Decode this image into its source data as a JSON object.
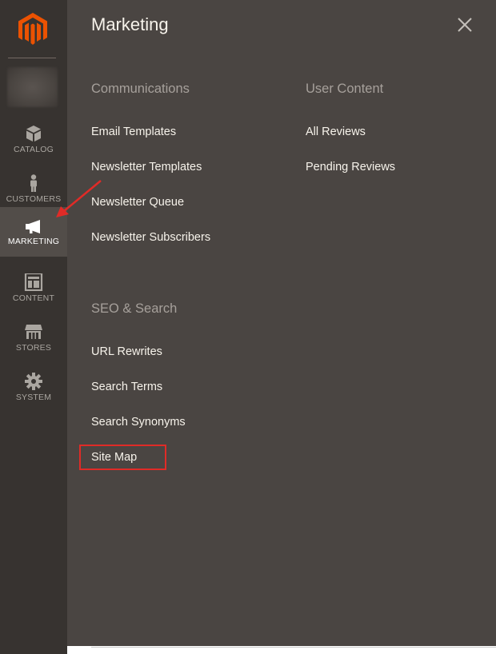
{
  "sidebar": {
    "items": [
      {
        "label": "CATALOG",
        "icon": "box-icon",
        "active": false
      },
      {
        "label": "CUSTOMERS",
        "icon": "person-icon",
        "active": false
      },
      {
        "label": "MARKETING",
        "icon": "megaphone-icon",
        "active": true
      },
      {
        "label": "CONTENT",
        "icon": "layout-icon",
        "active": false
      },
      {
        "label": "STORES",
        "icon": "storefront-icon",
        "active": false
      },
      {
        "label": "SYSTEM",
        "icon": "gear-icon",
        "active": false
      }
    ]
  },
  "panel": {
    "title": "Marketing",
    "sections": [
      {
        "title": "Communications",
        "links": [
          "Email Templates",
          "Newsletter Templates",
          "Newsletter Queue",
          "Newsletter Subscribers"
        ]
      },
      {
        "title": "User Content",
        "links": [
          "All Reviews",
          "Pending Reviews"
        ]
      },
      {
        "title": "SEO & Search",
        "links": [
          "URL Rewrites",
          "Search Terms",
          "Search Synonyms",
          "Site Map"
        ]
      }
    ]
  },
  "colors": {
    "sidebar_bg": "#373330",
    "panel_bg": "#4a4542",
    "logo_orange": "#eb5202",
    "annotation_red": "#e02b27"
  }
}
